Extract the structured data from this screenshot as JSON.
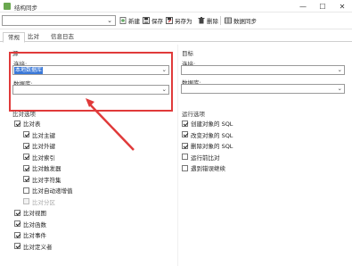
{
  "window": {
    "title": "结构同步"
  },
  "window_buttons": {
    "minimize": "—",
    "maximize": "☐",
    "close": "✕"
  },
  "toolbar": {
    "new_label": "新建",
    "save_label": "保存",
    "save_as_label": "另存为",
    "delete_label": "删除",
    "sync_label": "数据同步"
  },
  "tabs": [
    "常规",
    "比对",
    "信息日志"
  ],
  "source": {
    "group_label": "源",
    "connection_label": "连接:",
    "connection_value": "本地数据库",
    "database_label": "数据库:",
    "database_value": ""
  },
  "target": {
    "group_label": "目标",
    "connection_label": "连接:",
    "connection_value": "",
    "database_label": "数据库:",
    "database_value": ""
  },
  "compare_options": {
    "label": "比对选项",
    "items": [
      {
        "label": "比对表",
        "checked": true,
        "indent": 0,
        "disabled": false
      },
      {
        "label": "比对主键",
        "checked": true,
        "indent": 1,
        "disabled": false
      },
      {
        "label": "比对外键",
        "checked": true,
        "indent": 1,
        "disabled": false
      },
      {
        "label": "比对索引",
        "checked": true,
        "indent": 1,
        "disabled": false
      },
      {
        "label": "比对触发器",
        "checked": true,
        "indent": 1,
        "disabled": false
      },
      {
        "label": "比对字符集",
        "checked": true,
        "indent": 1,
        "disabled": false
      },
      {
        "label": "比对自动递增值",
        "checked": false,
        "indent": 1,
        "disabled": false
      },
      {
        "label": "比对分区",
        "checked": false,
        "indent": 1,
        "disabled": true
      },
      {
        "label": "比对视图",
        "checked": true,
        "indent": 0,
        "disabled": false
      },
      {
        "label": "比对函数",
        "checked": true,
        "indent": 0,
        "disabled": false
      },
      {
        "label": "比对事件",
        "checked": true,
        "indent": 0,
        "disabled": false
      },
      {
        "label": "比对定义者",
        "checked": true,
        "indent": 0,
        "disabled": false
      }
    ]
  },
  "run_options": {
    "label": "运行选项",
    "items": [
      {
        "label": "创建对象的 SQL",
        "checked": true
      },
      {
        "label": "改变对象的 SQL",
        "checked": true
      },
      {
        "label": "删除对象的 SQL",
        "checked": true
      },
      {
        "label": "运行前比对",
        "checked": false
      },
      {
        "label": "遇到错误继续",
        "checked": false
      }
    ]
  },
  "colors": {
    "highlight_red": "#e03a3a",
    "selection_blue": "#3a78d8"
  }
}
